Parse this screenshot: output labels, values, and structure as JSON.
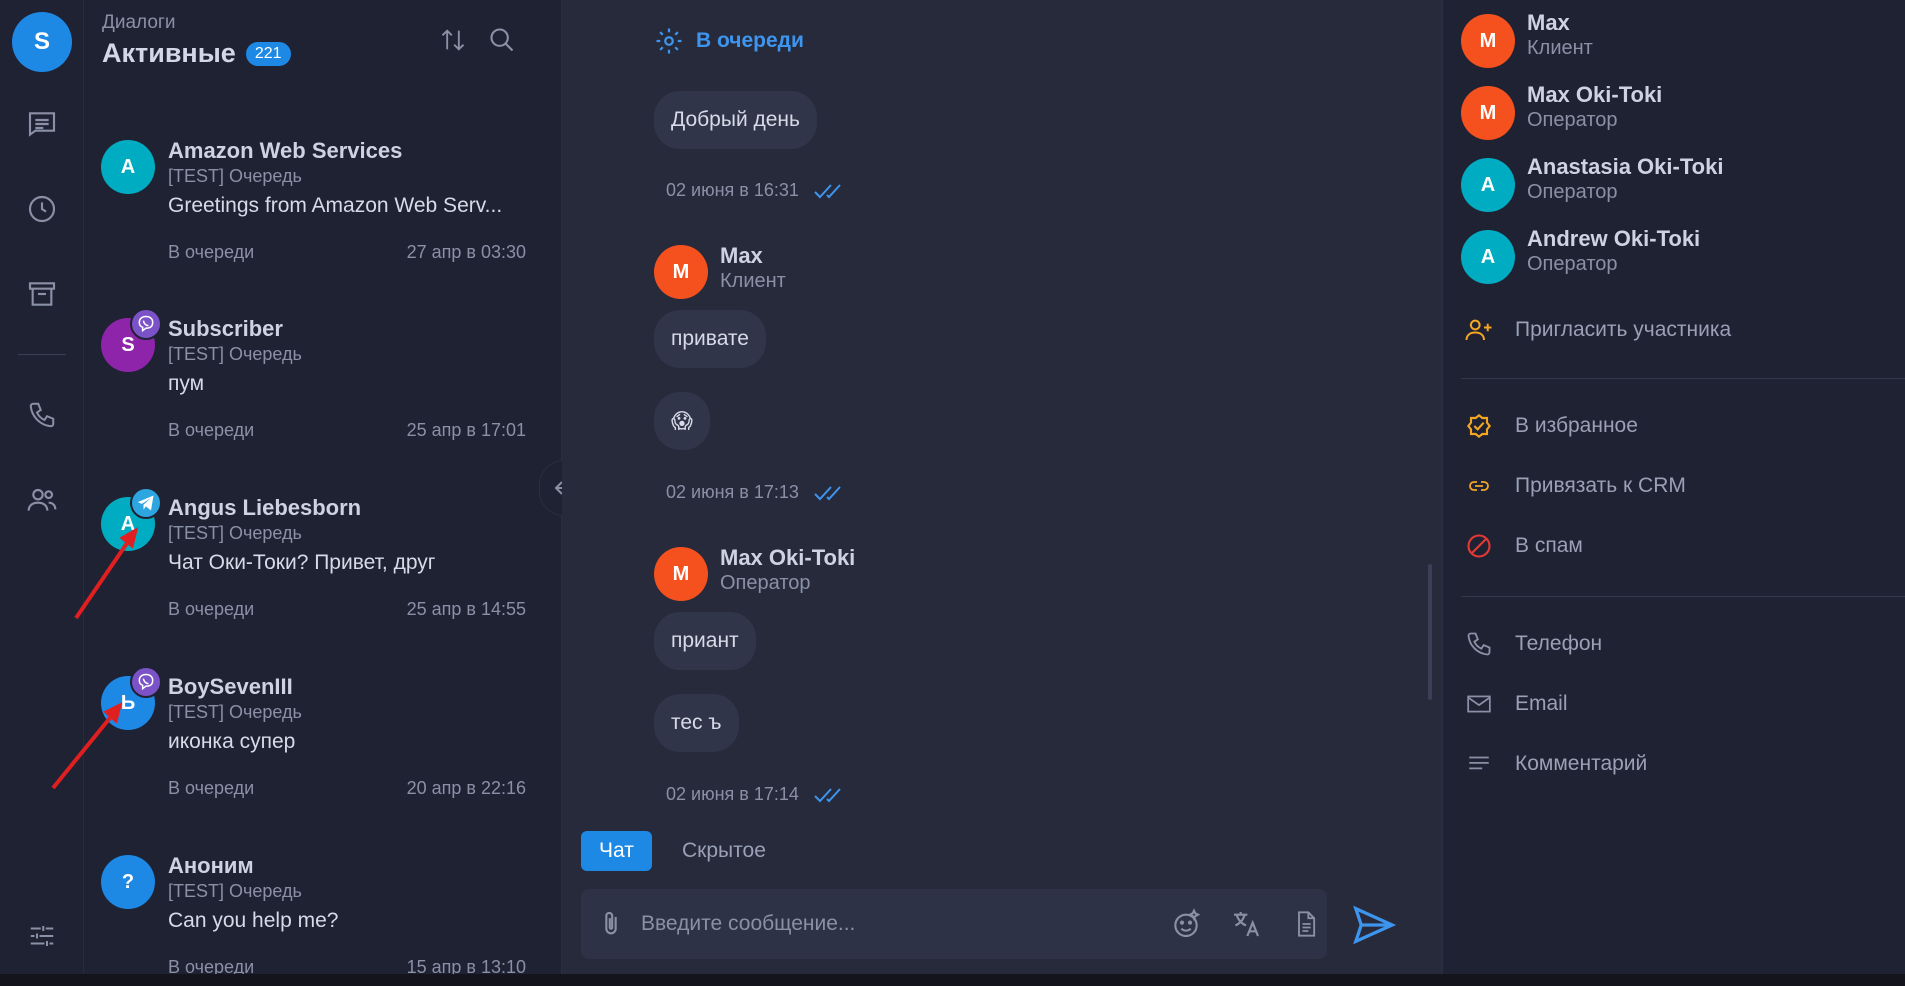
{
  "rail": {
    "user_initial": "S",
    "icons": [
      "chat-icon",
      "history-icon",
      "archive-icon",
      "phone-icon",
      "contacts-icon",
      "settings-sliders-icon"
    ]
  },
  "dialogs": {
    "subtitle": "Диалоги",
    "title": "Активные",
    "count": "221",
    "items": [
      {
        "initial": "A",
        "color": "#00acc1",
        "channel": "",
        "name": "Amazon Web Services",
        "queue": "[TEST] Очередь",
        "message": "Greetings from Amazon Web Serv...",
        "status": "В очереди",
        "time": "27 апр в 03:30"
      },
      {
        "initial": "S",
        "color": "#8e24aa",
        "channel": "viber",
        "name": "Subscriber",
        "queue": "[TEST] Очередь",
        "message": "пум",
        "status": "В очереди",
        "time": "25 апр в 17:01"
      },
      {
        "initial": "A",
        "color": "#00acc1",
        "channel": "telegram",
        "name": "Angus Liebesborn",
        "queue": "[TEST] Очередь",
        "message": "Чат Оки-Токи? Привет, друг",
        "status": "В очереди",
        "time": "25 апр в 14:55"
      },
      {
        "initial": "Ь",
        "color": "#1e88e5",
        "channel": "viber",
        "name": "BoySevenIII",
        "queue": "[TEST] Очередь",
        "message": "иконка супер",
        "status": "В очереди",
        "time": "20 апр в 22:16"
      },
      {
        "initial": "?",
        "color": "#1e88e5",
        "channel": "",
        "name": "Аноним",
        "queue": "[TEST] Очередь",
        "message": "Can you help me?",
        "status": "В очереди",
        "time": "15 апр в 13:10"
      }
    ]
  },
  "chat": {
    "queue_label": "В очереди",
    "messages": {
      "m1": "Добрый день",
      "t1": "02 июня в 16:31",
      "sender1_initial": "M",
      "sender1_name": "Max",
      "sender1_role": "Клиент",
      "m2": "привате",
      "m3": "😱",
      "t2": "02 июня в 17:13",
      "sender2_initial": "M",
      "sender2_name": "Max Oki-Toki",
      "sender2_role": "Оператор",
      "m4": "приант",
      "m5": "тес ъ",
      "t3": "02 июня в 17:14"
    },
    "tabs": {
      "chat": "Чат",
      "hidden": "Скрытое"
    },
    "composer_placeholder": "Введите сообщение..."
  },
  "side": {
    "participants": [
      {
        "initial": "M",
        "color": "#f4511e",
        "name": "Max",
        "role": "Клиент"
      },
      {
        "initial": "M",
        "color": "#f4511e",
        "name": "Max Oki-Toki",
        "role": "Оператор"
      },
      {
        "initial": "A",
        "color": "#00acc1",
        "name": "Anastasia Oki-Toki",
        "role": "Оператор"
      },
      {
        "initial": "A",
        "color": "#00acc1",
        "name": "Andrew Oki-Toki",
        "role": "Оператор"
      }
    ],
    "invite": "Пригласить участника",
    "favorite": "В избранное",
    "crm": "Привязать к CRM",
    "spam": "В спам",
    "phone": "Телефон",
    "email": "Email",
    "comment": "Комментарий"
  },
  "colors": {
    "accent": "#1e88e5",
    "link": "#3d95ee",
    "warning": "#f5a623",
    "danger": "#e53935",
    "viber": "#7b52c7",
    "telegram": "#2ca5e0"
  }
}
